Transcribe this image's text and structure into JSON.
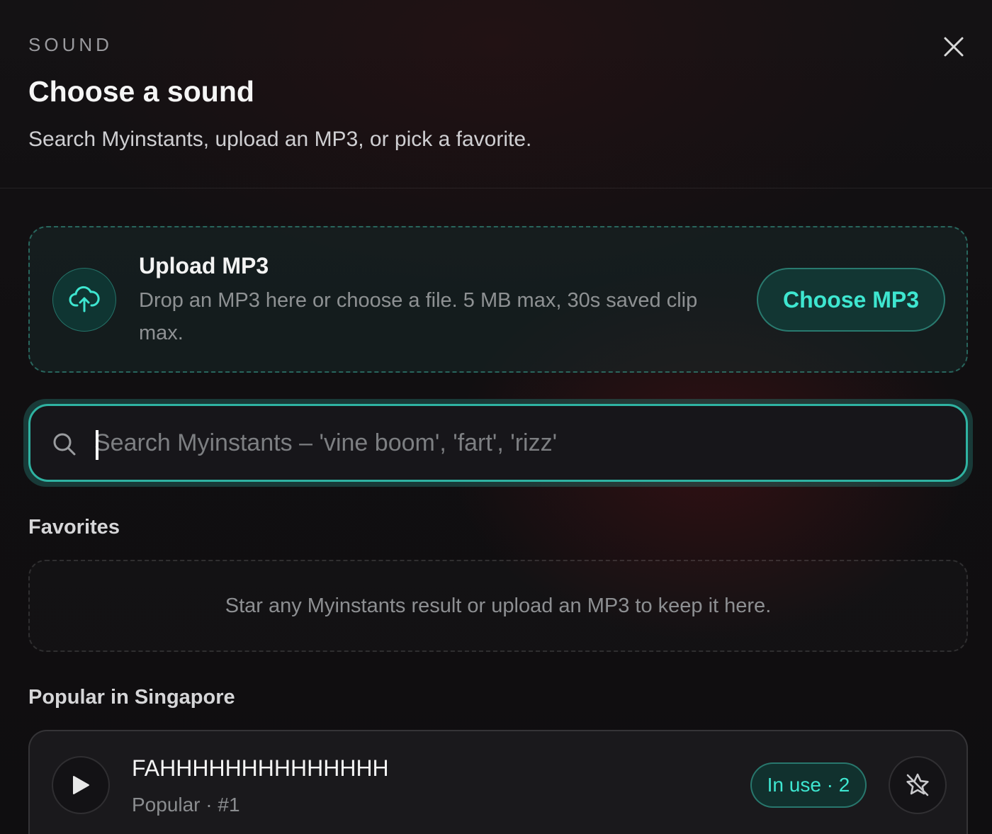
{
  "header": {
    "eyebrow": "SOUND",
    "title": "Choose a sound",
    "subtitle": "Search Myinstants, upload an MP3, or pick a favorite.",
    "close_icon": "close-icon"
  },
  "upload": {
    "icon": "cloud-upload-icon",
    "title": "Upload MP3",
    "description": "Drop an MP3 here or choose a file. 5 MB max, 30s saved clip max.",
    "button_label": "Choose MP3"
  },
  "search": {
    "icon": "search-icon",
    "value": "",
    "placeholder": "Search Myinstants – 'vine boom', 'fart', 'rizz'"
  },
  "favorites": {
    "label": "Favorites",
    "empty_text": "Star any Myinstants result or upload an MP3 to keep it here."
  },
  "popular": {
    "label": "Popular in Singapore",
    "items": [
      {
        "name": "FAHHHHHHHHHHHHHH",
        "meta": "Popular · #1",
        "badge": "In use · 2",
        "play_icon": "play-icon",
        "favorite_icon": "star-off-icon"
      }
    ]
  },
  "colors": {
    "accent": "#3ee6d0",
    "accent_border": "#2fb3a2",
    "background": "#111013"
  }
}
